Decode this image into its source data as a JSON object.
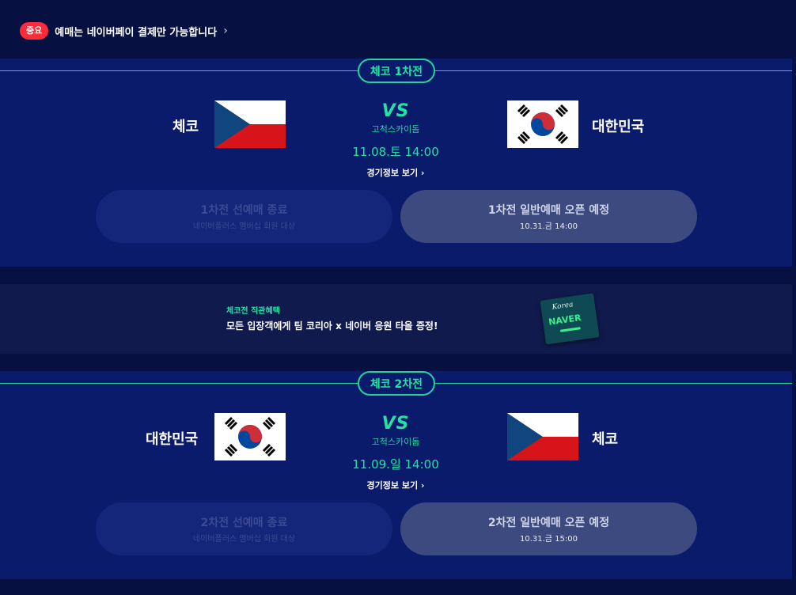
{
  "notice": {
    "badge": "중요",
    "text": "예매는 네이버페이 결제만 가능합니다",
    "chevron": "chevron-right-icon"
  },
  "matches": [
    {
      "round": "체코 1차전",
      "left_team": "체코",
      "right_team": "대한민국",
      "left_flag": "czech-flag",
      "right_flag": "korea-flag",
      "vs": "VS",
      "venue": "고척스카이돔",
      "datetime": "11.08.토 14:00",
      "detail_link": "경기정보 보기 ›",
      "presale": {
        "title": "1차전 선예매 종료",
        "sub": "네이버플러스 멤버십 회원 대상"
      },
      "general": {
        "title": "1차전 일반예매 오픈 예정",
        "sub": "10.31.금 14:00"
      }
    },
    {
      "round": "체코 2차전",
      "left_team": "대한민국",
      "right_team": "체코",
      "left_flag": "korea-flag",
      "right_flag": "czech-flag",
      "vs": "VS",
      "venue": "고척스카이돔",
      "datetime": "11.09.일 14:00",
      "detail_link": "경기정보 보기 ›",
      "presale": {
        "title": "2차전 선예매 종료",
        "sub": "네이버플러스 멤버십 회원 대상"
      },
      "general": {
        "title": "2차전 일반예매 오픈 예정",
        "sub": "10.31.금 15:00"
      }
    }
  ],
  "benefit": {
    "label": "체코전 직관혜택",
    "text": "모든 입장객에게 팀 코리아 x 네이버 응원 타올 증정!",
    "towel_script": "Korea",
    "towel_brand": "NAVER"
  },
  "colors": {
    "accent": "#22e3a3",
    "background": "#071141",
    "panel": "#0b1b6c",
    "badge_red": "#ff2a3a"
  }
}
